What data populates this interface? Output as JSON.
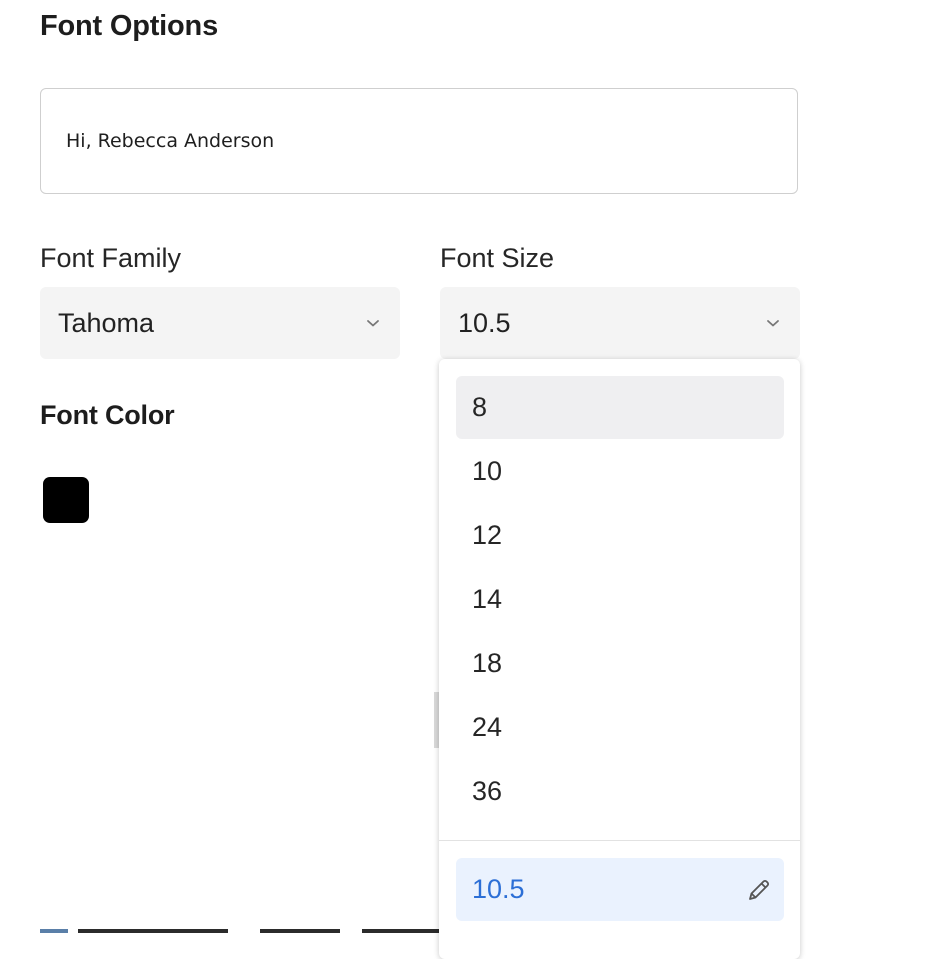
{
  "title": "Font Options",
  "preview": {
    "text": "Hi, Rebecca Anderson"
  },
  "font_family": {
    "label": "Font Family",
    "value": "Tahoma"
  },
  "font_size": {
    "label": "Font Size",
    "value": "10.5",
    "options": [
      "8",
      "10",
      "12",
      "14",
      "18",
      "24",
      "36"
    ],
    "highlighted_option": "8",
    "custom_value": "10.5"
  },
  "font_color": {
    "label": "Font Color",
    "value": "#000000"
  },
  "colors": {
    "accent": "#2c6fd6",
    "custom_bg": "#eaf2fe",
    "hover_bg": "#efeff1",
    "select_bg": "#f4f4f4"
  },
  "icons": {
    "select_chevron": "chevron-down-icon",
    "edit": "pencil-icon"
  }
}
